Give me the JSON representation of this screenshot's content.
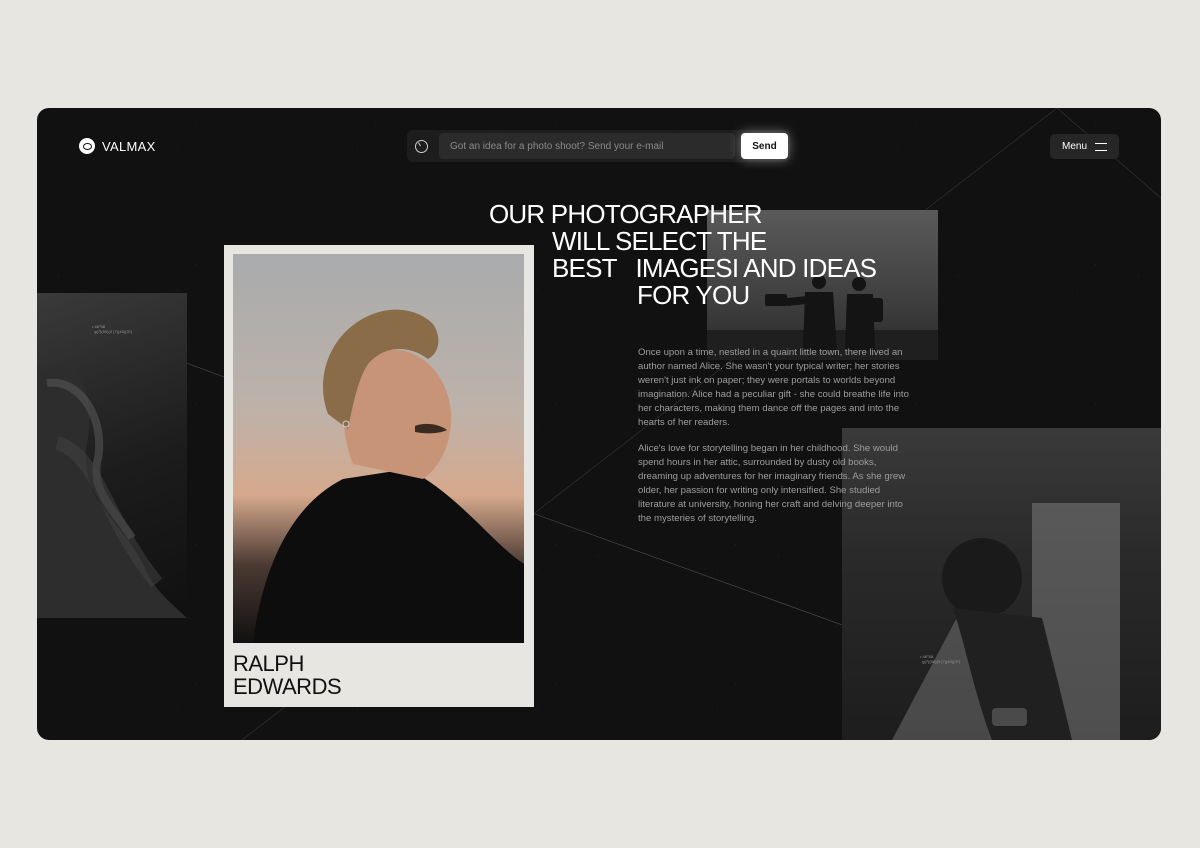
{
  "brand": {
    "name": "VALMAX",
    "logo_icon": "eye-logo-icon"
  },
  "search": {
    "placeholder": "Got an idea for a photo shoot? Send your e-mail",
    "value": "",
    "send_label": "Send",
    "icon": "clock-icon"
  },
  "menu": {
    "label": "Menu",
    "icon": "hamburger-icon"
  },
  "headline": {
    "line1": "OUR PHOTOGRAPHER",
    "line2": "WILL SELECT THE",
    "line3": "BEST   IMAGESI AND IDEAS",
    "line4": "FOR YOU"
  },
  "story": {
    "paragraph1": "Once upon a time, nestled in a quaint little town, there lived an author named Alice. She wasn't your typical writer; her stories weren't just ink on paper; they were portals to worlds beyond imagination. Alice had a peculiar gift - she could breathe life into her characters, making them dance off the pages and into the hearts of her readers.",
    "paragraph2": "Alice's love for storytelling began in her childhood. She would spend hours in her attic, surrounded by dusty old books, dreaming up adventures for her imaginary friends. As she grew older, her passion for writing only intensified. She studied literature at university, honing her craft and delving deeper into the mysteries of storytelling."
  },
  "card": {
    "first_name": "RALPH",
    "last_name": "EDWARDS"
  },
  "photo_tags": {
    "left": "• 46°58 \n  g(7)(90)(3 (7)(40)(37)",
    "right": "• 46°58 \n  g(7)(90)(3 (7)(40)(37)"
  },
  "colors": {
    "page_bg": "#e8e6e1",
    "frame_bg": "#111111",
    "card_bg": "#e8e6e1",
    "accent": "#ffffff"
  }
}
